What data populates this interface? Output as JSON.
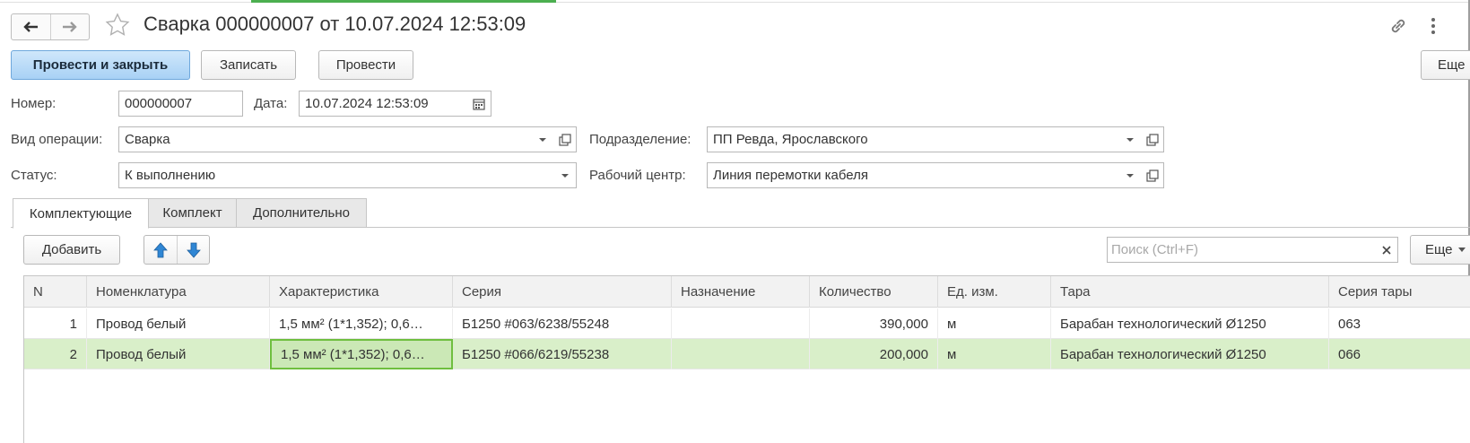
{
  "window": {
    "title": "Сварка 000000007 от 10.07.2024 12:53:09",
    "nav_back_icon": "arrow-left-icon",
    "nav_forward_icon": "arrow-right-icon",
    "favorite_icon": "star-icon",
    "link_icon": "link-icon",
    "more_icon": "more-vertical-icon"
  },
  "toolbar": {
    "post_and_close_label": "Провести и закрыть",
    "save_label": "Записать",
    "post_label": "Провести",
    "more_label": "Еще"
  },
  "form": {
    "number_label": "Номер:",
    "number_value": "000000007",
    "date_label": "Дата:",
    "date_value": "10.07.2024 12:53:09",
    "operation_label": "Вид операции:",
    "operation_value": "Сварка",
    "division_label": "Подразделение:",
    "division_value": "ПП Ревда, Ярославского",
    "status_label": "Статус:",
    "status_value": "К выполнению",
    "work_center_label": "Рабочий центр:",
    "work_center_value": "Линия перемотки кабеля"
  },
  "tabs": [
    {
      "label": "Комплектующие",
      "active": true
    },
    {
      "label": "Комплект",
      "active": false
    },
    {
      "label": "Дополнительно",
      "active": false
    }
  ],
  "table_toolbar": {
    "add_label": "Добавить",
    "search_placeholder": "Поиск (Ctrl+F)",
    "more_label": "Еще"
  },
  "table": {
    "columns": [
      "N",
      "Номенклатура",
      "Характеристика",
      "Серия",
      "Назначение",
      "Количество",
      "Ед. изм.",
      "Тара",
      "Серия тары"
    ],
    "rows": [
      {
        "n": "1",
        "nomenclature": "Провод белый",
        "characteristic": "1,5 мм² (1*1,352); 0,6…",
        "series": "Б1250 #063/6238/55248",
        "purpose": "",
        "quantity": "390,000",
        "unit": "м",
        "container": "Барабан технологический Ø1250",
        "container_series": "063",
        "selected": false
      },
      {
        "n": "2",
        "nomenclature": "Провод белый",
        "characteristic": "1,5 мм² (1*1,352); 0,6…",
        "series": "Б1250 #066/6219/55238",
        "purpose": "",
        "quantity": "200,000",
        "unit": "м",
        "container": "Барабан технологический Ø1250",
        "container_series": "066",
        "selected": true
      }
    ]
  },
  "colors": {
    "primary_button": "#a8d1f5",
    "selected_row": "#d9efc9",
    "focus_cell_border": "#6fbf3f",
    "arrow_blue": "#2f86d4"
  }
}
